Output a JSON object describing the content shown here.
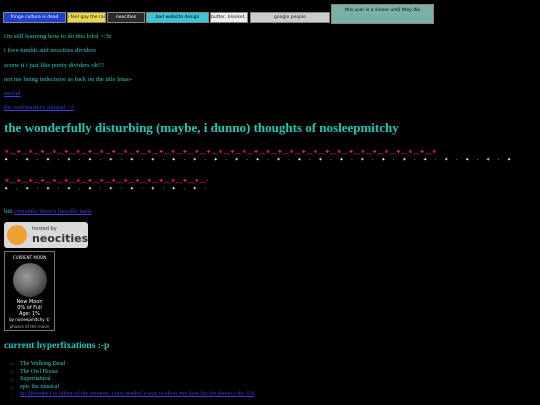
{
  "buttons": [
    {
      "label": "fringe culture is dead",
      "bg": "#1a3fd1",
      "fg": "#ffffff"
    },
    {
      "label": "i feel gay the rainbow",
      "bg": "#e8d84a",
      "fg": "#222222"
    },
    {
      "label": "neocities",
      "bg": "#2a2a2a",
      "fg": "#ffffff"
    },
    {
      "label": "bad website design",
      "bg": "#39c6d6",
      "fg": "#000000"
    },
    {
      "label": "butter, blanket, bottom",
      "bg": "#eeeeee",
      "fg": "#222222"
    },
    {
      "label": "google people",
      "bg": "#cccccc",
      "fg": "#222222"
    },
    {
      "label": "this user is a sinner until they die",
      "bg": "#7bb0a8",
      "fg": "#000000"
    }
  ],
  "intro_lines": [
    "i'm still learning how to do this lolol >:3c",
    "i love tumblr and neocities dividers",
    "screw it i just like pretty dividers ok!!!",
    "not me being indecisive as fuck on the title lmao-"
  ],
  "links": {
    "link1": "neoful",
    "link2": "the webmaster's journal <3"
  },
  "heading": "the wonderfully disturbing (maybe, i dunno) thoughts of nosleepmitchy",
  "dividers": {
    "row1_top": "✶︵✦︵✶︵✦︵✶︵✦︵✶︵✦︵✶︵✦︵✶︵✦︵✶︵✦︵✶︵✦︵✶︵✦︵✶︵✦︵✶︵✦︵✶︵✦︵✶︵✦︵✶︵✦︵✶︵✦︵✶︵✦︵✶︵✦︵✶︵✦︵✶",
    "row1_bottom": "✦ · ✶ · ✦ · ✶ · ✦ · ✶ · ✦ · ✶ · ✦ · ✶ · ✦ · ✶ · ✦ · ✶ · ✦ · ✶ · ✦ · ✶ · ✦ · ✶ · ✦ · ✶ · ✦ · ✶ · ✦ · ✶ · ✦",
    "row2_top": "✶︵✦︵✶︵✦︵✶︵✦︵✶︵✦︵✶︵✦︵✶︵✦︵✶︵✦︵✶︵✦︵✶︵✦︵✶︵✦︵✶︵✦︵✶",
    "row2_bottom": "✦ · ✶ · ✦ · ✶ · ✦ · ✶ · ✦ · ✶ · ✦ · ✶ · ✦ · ✶ · ✦"
  },
  "hiii_text": "hiii",
  "hiii_link": "currently there's literally nada",
  "neocities_badge": {
    "small": "hosted by",
    "big": "neocities"
  },
  "moon": {
    "title": "CURRENT MOON",
    "phase": "New Moon",
    "full": "0% of Full",
    "age": "Age: 1%",
    "credit": "by nosleepmitchy ©",
    "footer": "phases of the moon"
  },
  "hyperfixations": {
    "heading": "current hyperfixations :-p",
    "items": [
      {
        "text": "The Walking Dead",
        "link": false
      },
      {
        "text": "The Owl House",
        "link": false
      },
      {
        "text": "Supernatural",
        "link": false
      },
      {
        "text": "epic the musical",
        "link": false
      },
      {
        "text": "no disrespect to either of the creators, i just needed a way to show my love for the shows i do. 0.0",
        "link": true
      }
    ]
  }
}
